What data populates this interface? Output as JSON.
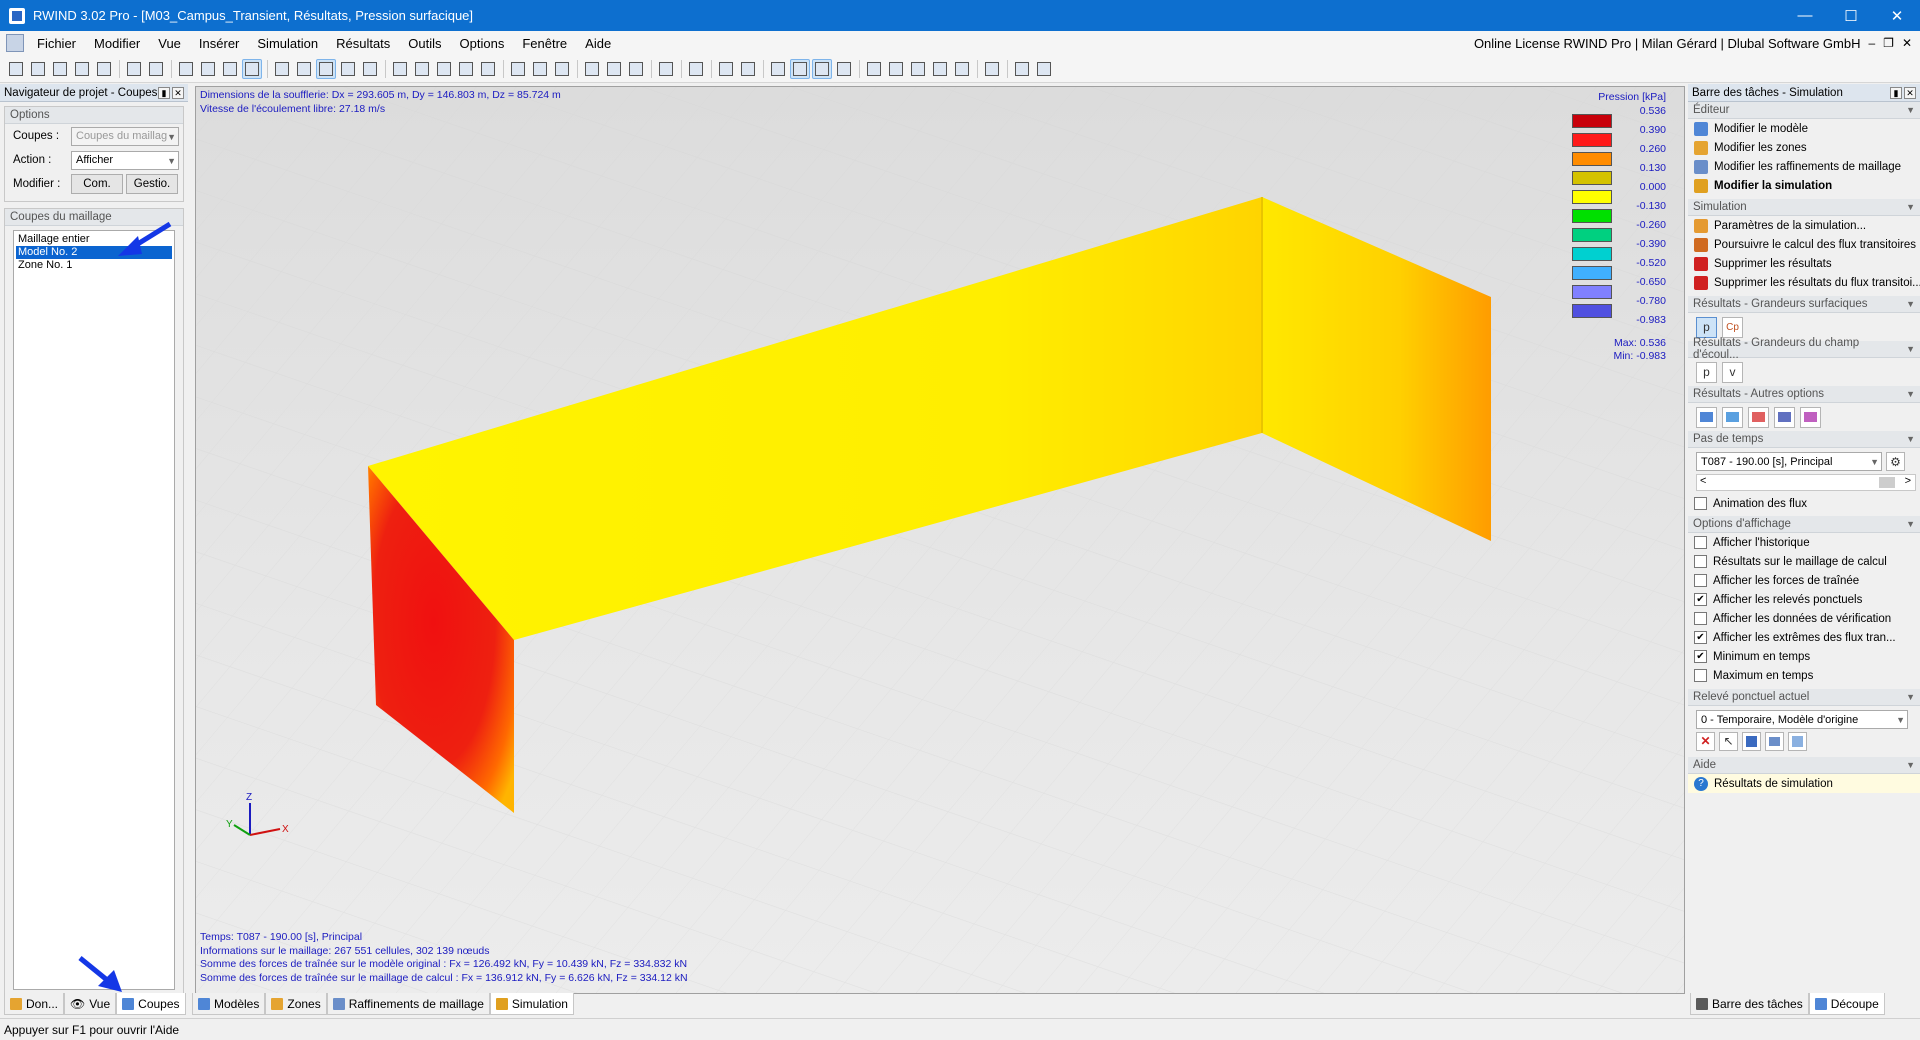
{
  "window": {
    "title": "RWIND 3.02 Pro - [M03_Campus_Transient, Résultats, Pression surfacique]"
  },
  "menu": {
    "items": [
      "Fichier",
      "Modifier",
      "Vue",
      "Insérer",
      "Simulation",
      "Résultats",
      "Outils",
      "Options",
      "Fenêtre",
      "Aide"
    ],
    "license": "Online License RWIND Pro | Milan Gérard | Dlubal Software GmbH"
  },
  "navigator": {
    "title": "Navigateur de projet - Coupes",
    "options_header": "Options",
    "coupes_label": "Coupes :",
    "coupes_value": "Coupes du maillag",
    "action_label": "Action :",
    "action_value": "Afficher",
    "modifier_label": "Modifier :",
    "com_button": "Com.",
    "gestio_button": "Gestio.",
    "list_header": "Coupes du maillage",
    "list": [
      "Maillage entier",
      "Model No. 2",
      "Zone No. 1"
    ],
    "tabs": [
      "Don...",
      "Vue",
      "Coupes"
    ]
  },
  "main_tabs": [
    "Modèles",
    "Zones",
    "Raffinements de maillage",
    "Simulation"
  ],
  "viewport": {
    "top_line1": "Dimensions de la soufflerie: Dx = 293.605 m, Dy = 146.803 m, Dz = 85.724 m",
    "top_line2": "Vitesse de l'écoulement libre: 27.18 m/s",
    "bottom_lines": [
      "Temps: T087 - 190.00 [s], Principal",
      "Informations sur le maillage: 267 551 cellules, 302 139 nœuds",
      "Somme des forces de traînée sur le modèle original : Fx = 126.492 kN, Fy = 10.439 kN, Fz = 334.832 kN",
      "Somme des forces de traînée sur le maillage de calcul : Fx = 136.912 kN, Fy = 6.626 kN, Fz = 334.12 kN"
    ],
    "axes": {
      "x": "X",
      "y": "Y",
      "z": "Z"
    }
  },
  "legend": {
    "title": "Pression [kPa]",
    "levels": [
      "0.536",
      "0.390",
      "0.260",
      "0.130",
      "0.000",
      "-0.130",
      "-0.260",
      "-0.390",
      "-0.520",
      "-0.650",
      "-0.780",
      "-0.983"
    ],
    "colors": [
      "#c8000a",
      "#ff1a1a",
      "#ff8c00",
      "#d4c200",
      "#ffff00",
      "#00e000",
      "#00d080",
      "#00d0d0",
      "#40b0ff",
      "#8080ff",
      "#5050e0",
      "#0000c8"
    ],
    "max_label": "Max:",
    "max_value": "0.536",
    "min_label": "Min:",
    "min_value": "-0.983"
  },
  "taskbar": {
    "title": "Barre des tâches - Simulation",
    "editor_header": "Éditeur",
    "editor_items": [
      "Modifier le modèle",
      "Modifier les zones",
      "Modifier les raffinements de maillage",
      "Modifier la simulation"
    ],
    "simulation_header": "Simulation",
    "simulation_items": [
      "Paramètres de la simulation...",
      "Poursuivre le calcul des flux transitoires",
      "Supprimer les résultats",
      "Supprimer les résultats du flux transitoi..."
    ],
    "surface_header": "Résultats - Grandeurs surfaciques",
    "surface_buttons": [
      "p",
      "Cp"
    ],
    "field_header": "Résultats - Grandeurs du champ d'écoul...",
    "field_buttons": [
      "p",
      "v"
    ],
    "other_header": "Résultats - Autres options",
    "timestep_header": "Pas de temps",
    "timestep_value": "T087 - 190.00 [s], Principal",
    "animation_label": "Animation des flux",
    "display_header": "Options d'affichage",
    "display_options": [
      {
        "label": "Afficher l'historique",
        "checked": false
      },
      {
        "label": "Résultats sur le maillage de calcul",
        "checked": false
      },
      {
        "label": "Afficher les forces de traînée",
        "checked": false
      },
      {
        "label": "Afficher les relevés ponctuels",
        "checked": true
      },
      {
        "label": "Afficher les données de vérification",
        "checked": false
      },
      {
        "label": "Afficher les extrêmes des flux tran...",
        "checked": true
      },
      {
        "label": "Minimum en temps",
        "checked": true
      },
      {
        "label": "Maximum en temps",
        "checked": false
      }
    ],
    "probe_header": "Relevé ponctuel actuel",
    "probe_value": "0 - Temporaire, Modèle d'origine",
    "help_header": "Aide",
    "help_item": "Résultats de simulation",
    "tabs": [
      "Barre des tâches",
      "Découpe"
    ]
  },
  "status": {
    "text": "Appuyer sur F1 pour ouvrir l'Aide"
  }
}
